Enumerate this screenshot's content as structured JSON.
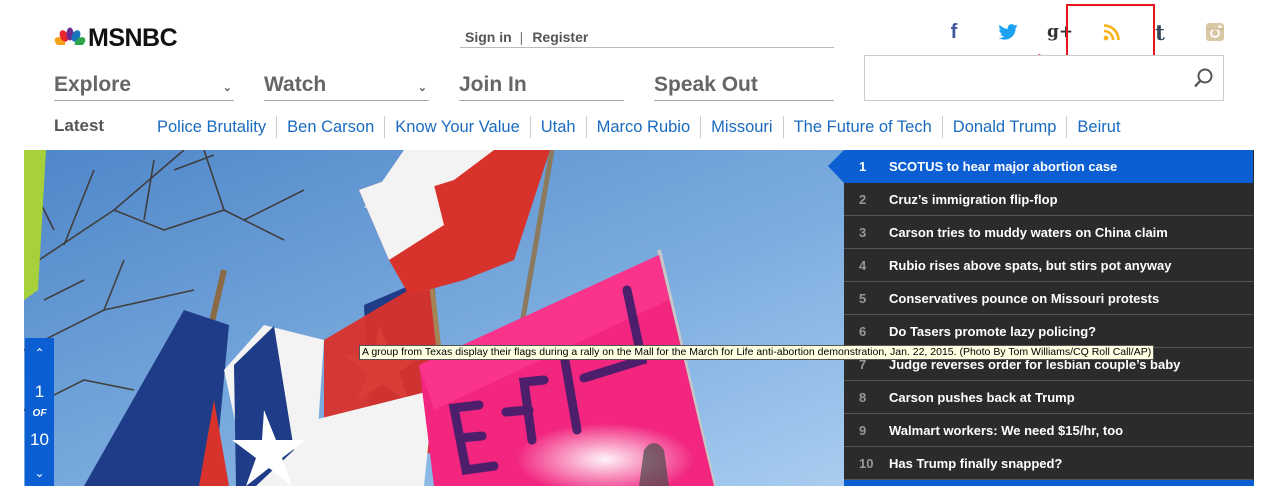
{
  "brand": {
    "logo_text": "MSNBC"
  },
  "auth": {
    "sign_in": "Sign in",
    "separator": "|",
    "register": "Register"
  },
  "social": {
    "facebook_glyph": "f",
    "googleplus_glyph": "g+",
    "tumblr_glyph": "t",
    "icons": [
      "facebook-icon",
      "twitter-icon",
      "google-plus-icon",
      "rss-icon",
      "tumblr-icon",
      "instagram-icon"
    ],
    "colors": {
      "facebook": "#3b5998",
      "twitter": "#1da1f2",
      "rss": "#f6b21a",
      "tumblr": "#35465c",
      "instagram": "#d9c8a6",
      "highlight": "#e8151b"
    }
  },
  "nav": [
    {
      "label": "Explore",
      "has_dropdown": true
    },
    {
      "label": "Watch",
      "has_dropdown": true
    },
    {
      "label": "Join In",
      "has_dropdown": false
    },
    {
      "label": "Speak Out",
      "has_dropdown": false
    }
  ],
  "search": {
    "value": "",
    "placeholder": ""
  },
  "latest": {
    "label": "Latest",
    "links": [
      "Police Brutality",
      "Ben Carson",
      "Know Your Value",
      "Utah",
      "Marco Rubio",
      "Missouri",
      "The Future of Tech",
      "Donald Trump",
      "Beirut"
    ]
  },
  "slideshow": {
    "current": "1",
    "of_label": "OF",
    "total": "10"
  },
  "tooltip": "A group from Texas display their flags during a rally on the Mall for the March for Life anti-abortion demonstration, Jan. 22, 2015. (Photo By Tom Williams/CQ Roll Call/AP)",
  "hero_banner_text": "LIFE",
  "headlines": [
    {
      "num": "1",
      "text": "SCOTUS to hear major abortion case"
    },
    {
      "num": "2",
      "text": "Cruz’s immigration flip-flop"
    },
    {
      "num": "3",
      "text": "Carson tries to muddy waters on China claim"
    },
    {
      "num": "4",
      "text": "Rubio rises above spats, but stirs pot anyway"
    },
    {
      "num": "5",
      "text": "Conservatives pounce on Missouri protests"
    },
    {
      "num": "6",
      "text": "Do Tasers promote lazy policing?"
    },
    {
      "num": "7",
      "text": "Judge reverses order for lesbian couple’s baby"
    },
    {
      "num": "8",
      "text": "Carson pushes back at Trump"
    },
    {
      "num": "9",
      "text": "Walmart workers: We need $15/hr, too"
    },
    {
      "num": "10",
      "text": "Has Trump finally snapped?"
    }
  ]
}
